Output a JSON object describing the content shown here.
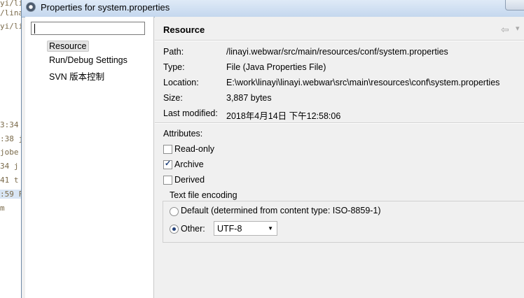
{
  "background_editor": {
    "fragments": [
      "yi/lina",
      "/linay",
      "yi/lina",
      "3:34",
      ":38 j",
      "jobe",
      "34 j",
      "41 t",
      ":59 F",
      "m"
    ]
  },
  "window": {
    "title": "Properties for system.properties",
    "icon": "eclipse-icon"
  },
  "nav": {
    "filter": {
      "value": "",
      "placeholder": ""
    },
    "items": [
      {
        "label": "Resource",
        "selected": true
      },
      {
        "label": "Run/Debug Settings",
        "selected": false
      },
      {
        "label": "SVN 版本控制",
        "selected": false
      }
    ]
  },
  "content": {
    "title": "Resource",
    "nav_icons": [
      "back-arrow-icon",
      "forward-arrow-icon"
    ],
    "properties": [
      {
        "label": "Path:",
        "value": "/linayi.webwar/src/main/resources/conf/system.properties"
      },
      {
        "label": "Type:",
        "value": "File  (Java Properties File)"
      },
      {
        "label": "Location:",
        "value": "E:\\work\\linayi\\linayi.webwar\\src\\main\\resources\\conf\\system.properties"
      },
      {
        "label": "Size:",
        "value": "3,887  bytes"
      },
      {
        "label": "Last modified:",
        "value": "2018年4月14日 下午12:58:06"
      }
    ],
    "attributes": {
      "heading": "Attributes:",
      "items": [
        {
          "label": "Read-only",
          "checked": false
        },
        {
          "label": "Archive",
          "checked": true
        },
        {
          "label": "Derived",
          "checked": false
        }
      ]
    },
    "encoding": {
      "legend": "Text file encoding",
      "default_label": "Default (determined from content type: ISO-8859-1)",
      "default_selected": false,
      "other_label": "Other:",
      "other_selected": true,
      "other_value": "UTF-8"
    }
  },
  "colors": {
    "titlebar": "#c4d7ee",
    "window_bg": "#f0f0f0",
    "radio_dot": "#24427a"
  }
}
